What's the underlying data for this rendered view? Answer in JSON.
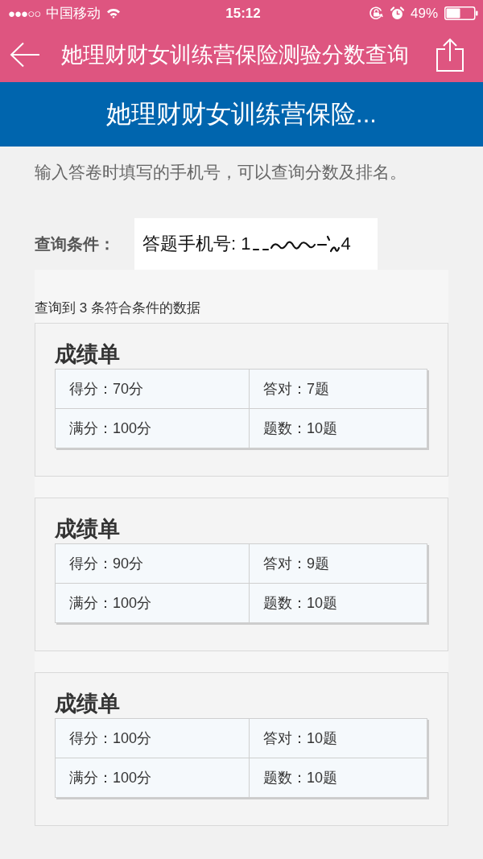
{
  "status_bar": {
    "signal": "●●●○○",
    "carrier": "中国移动",
    "time": "15:12",
    "battery": "49%"
  },
  "nav_bar": {
    "title": "她理财财女训练营保险测验分数查询"
  },
  "banner": {
    "title": "她理财财女训练营保险..."
  },
  "intro": "输入答卷时填写的手机号，可以查询分数及排名。",
  "query": {
    "label": "查询条件：",
    "value": "答题手机号: 1",
    "value_tail": "4"
  },
  "results": {
    "summary": "查询到 3 条符合条件的数据",
    "cards": [
      {
        "title": "成绩单",
        "cells": [
          "得分：70分",
          "答对：7题",
          "满分：100分",
          "题数：10题"
        ]
      },
      {
        "title": "成绩单",
        "cells": [
          "得分：90分",
          "答对：9题",
          "满分：100分",
          "题数：10题"
        ]
      },
      {
        "title": "成绩单",
        "cells": [
          "得分：100分",
          "答对：10题",
          "满分：100分",
          "题数：10题"
        ]
      }
    ]
  }
}
